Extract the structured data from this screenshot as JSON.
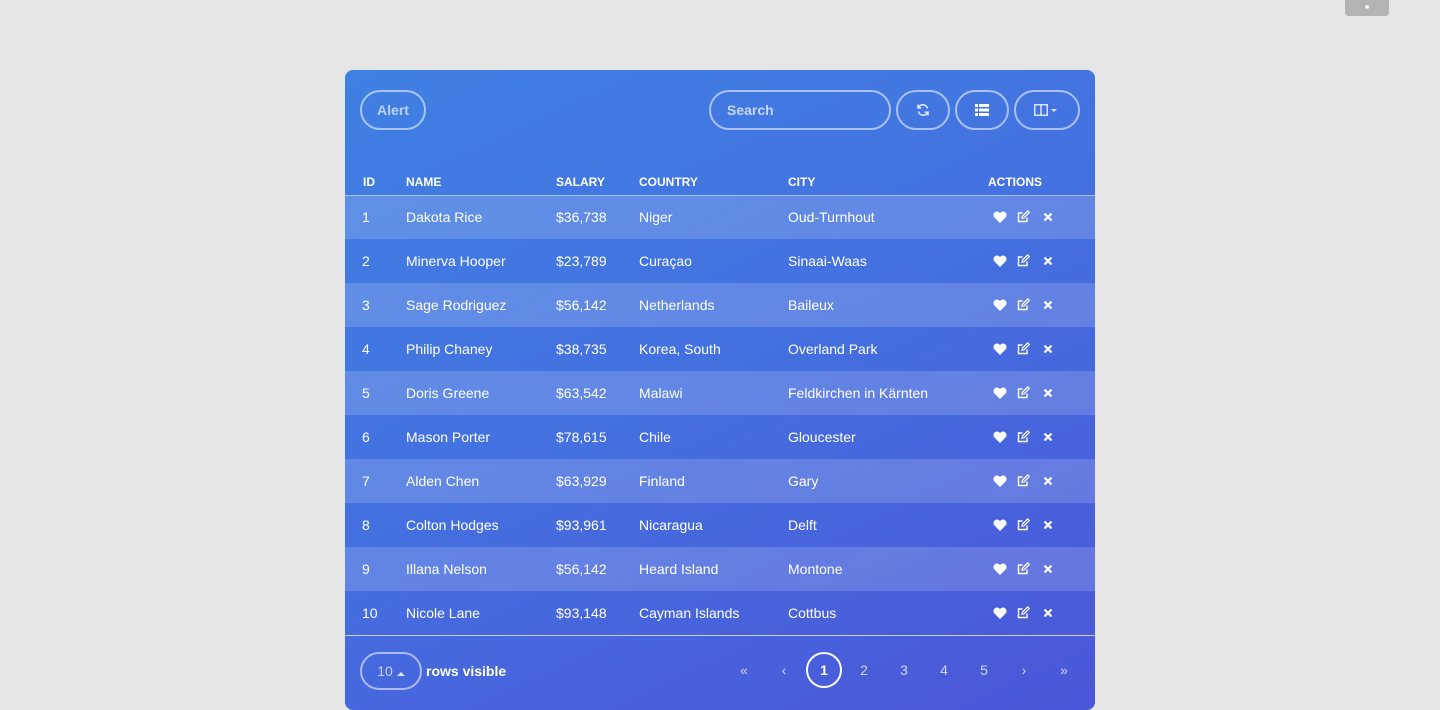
{
  "toolbar": {
    "alert_label": "Alert",
    "search_placeholder": "Search",
    "refresh_icon": "refresh-icon",
    "list_icon": "list-icon",
    "columns_icon": "columns-icon"
  },
  "table": {
    "headers": [
      "ID",
      "NAME",
      "SALARY",
      "COUNTRY",
      "CITY",
      "ACTIONS"
    ],
    "rows": [
      {
        "id": "1",
        "name": "Dakota Rice",
        "salary": "$36,738",
        "country": "Niger",
        "city": "Oud-Turnhout"
      },
      {
        "id": "2",
        "name": "Minerva Hooper",
        "salary": "$23,789",
        "country": "Curaçao",
        "city": "Sinaai-Waas"
      },
      {
        "id": "3",
        "name": "Sage Rodriguez",
        "salary": "$56,142",
        "country": "Netherlands",
        "city": "Baileux"
      },
      {
        "id": "4",
        "name": "Philip Chaney",
        "salary": "$38,735",
        "country": "Korea, South",
        "city": "Overland Park"
      },
      {
        "id": "5",
        "name": "Doris Greene",
        "salary": "$63,542",
        "country": "Malawi",
        "city": "Feldkirchen in Kärnten"
      },
      {
        "id": "6",
        "name": "Mason Porter",
        "salary": "$78,615",
        "country": "Chile",
        "city": "Gloucester"
      },
      {
        "id": "7",
        "name": "Alden Chen",
        "salary": "$63,929",
        "country": "Finland",
        "city": "Gary"
      },
      {
        "id": "8",
        "name": "Colton Hodges",
        "salary": "$93,961",
        "country": "Nicaragua",
        "city": "Delft"
      },
      {
        "id": "9",
        "name": "Illana Nelson",
        "salary": "$56,142",
        "country": "Heard Island",
        "city": "Montone"
      },
      {
        "id": "10",
        "name": "Nicole Lane",
        "salary": "$93,148",
        "country": "Cayman Islands",
        "city": "Cottbus"
      }
    ],
    "row_actions": [
      "heart-icon",
      "edit-icon",
      "remove-icon"
    ]
  },
  "footer": {
    "page_size": "10",
    "rows_visible_label": "rows visible",
    "pagination": {
      "first": "«",
      "prev": "‹",
      "pages": [
        "1",
        "2",
        "3",
        "4",
        "5"
      ],
      "current_page": "1",
      "next": "›",
      "last": "»"
    }
  }
}
